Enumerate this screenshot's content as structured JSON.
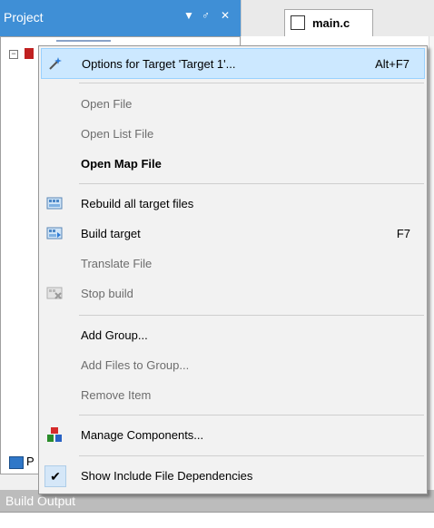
{
  "project_panel": {
    "title": "Project",
    "pin_glyph": "▼",
    "pin2_glyph": "♂",
    "close_glyph": "✕",
    "bottom_tab_letter": "P"
  },
  "editor": {
    "tab_label": "main.c"
  },
  "build_output": {
    "title": "Build Output"
  },
  "menu": {
    "items": [
      {
        "label": "Options for Target 'Target 1'...",
        "shortcut": "Alt+F7",
        "state": "highlighted",
        "icon": "options-wand-icon"
      },
      {
        "label": "Open File",
        "state": "disabled"
      },
      {
        "label": "Open List File",
        "state": "disabled"
      },
      {
        "label": "Open Map File",
        "state": "bold"
      },
      {
        "label": "Rebuild all target files",
        "state": "enabled",
        "icon": "rebuild-icon"
      },
      {
        "label": "Build target",
        "shortcut": "F7",
        "state": "enabled",
        "icon": "build-icon"
      },
      {
        "label": "Translate File",
        "state": "disabled"
      },
      {
        "label": "Stop build",
        "state": "disabled",
        "icon": "stop-build-icon"
      },
      {
        "label": "Add Group...",
        "state": "enabled"
      },
      {
        "label": "Add Files to Group...",
        "state": "disabled"
      },
      {
        "label": "Remove Item",
        "state": "disabled"
      },
      {
        "label": "Manage Components...",
        "state": "enabled",
        "icon": "components-icon"
      },
      {
        "label": "Show Include File Dependencies",
        "state": "checked",
        "check_glyph": "✔"
      }
    ]
  },
  "colors": {
    "project_header": "#3f8fd6",
    "highlight": "#cce8ff",
    "highlight_border": "#99d1ff"
  }
}
